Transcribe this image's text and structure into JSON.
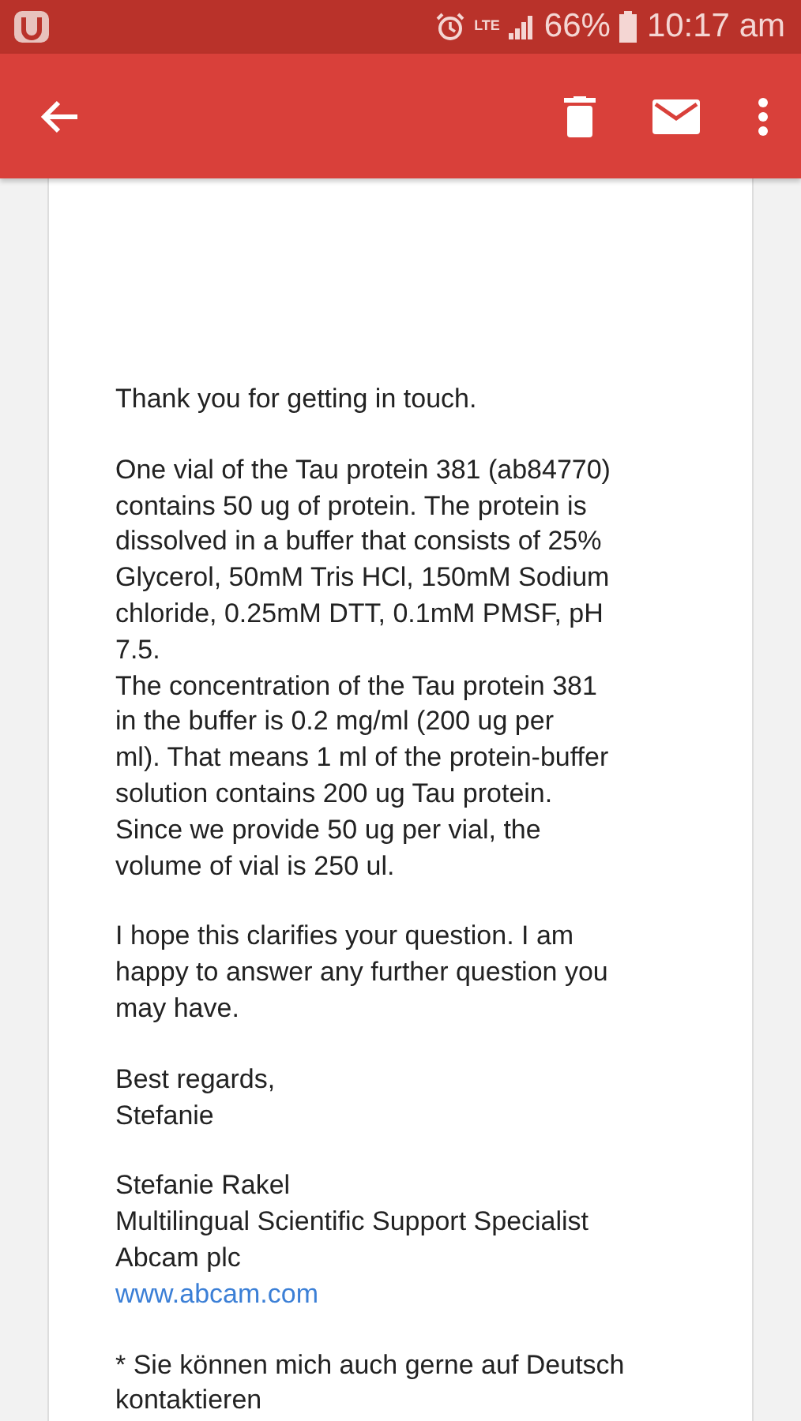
{
  "status_bar": {
    "network": "LTE",
    "battery": "66%",
    "time": "10:17 am"
  },
  "message": {
    "paragraphs": [
      "Thank you for getting in touch.",
      "One vial of the Tau protein 381 (ab84770)\ncontains 50 ug of protein. The protein is\ndissolved in a buffer that consists of 25%\nGlycerol, 50mM Tris HCl, 150mM Sodium\nchloride, 0.25mM DTT, 0.1mM PMSF, pH\n7.5.\nThe concentration of the Tau protein 381\nin the buffer is 0.2 mg/ml (200 ug per\nml). That means 1 ml of the protein-buffer\nsolution contains 200 ug Tau protein.\nSince we provide 50 ug per vial, the\nvolume of vial is 250 ul.",
      "I hope this clarifies your question. I am\nhappy to answer any further question you\nmay have.",
      "Best regards,\nStefanie"
    ],
    "signature": {
      "lines": "Stefanie Rakel\nMultilingual Scientific Support Specialist\nAbcam plc",
      "link": "www.abcam.com"
    },
    "footnote": "* Sie können mich auch gerne auf Deutsch\nkontaktieren"
  }
}
